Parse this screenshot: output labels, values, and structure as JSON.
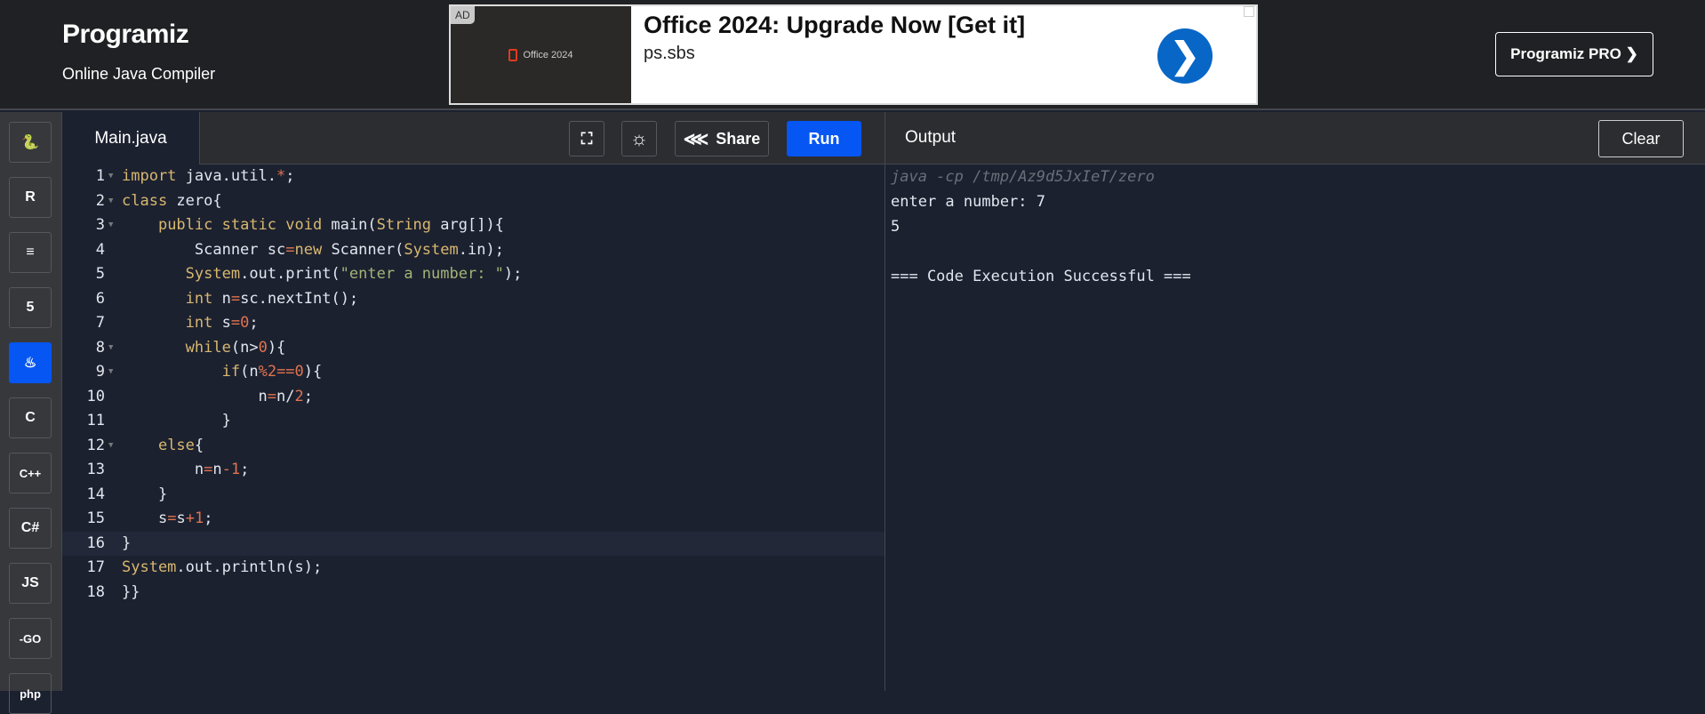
{
  "header": {
    "logo": "Programiz",
    "subtitle": "Online Java Compiler",
    "pro_button": "Programiz PRO ❯"
  },
  "ad": {
    "badge": "AD",
    "image_text": "Office 2024",
    "title": "Office 2024: Upgrade Now [Get it]",
    "url": "ps.sbs",
    "arrow": "❯"
  },
  "sidebar": {
    "items": [
      {
        "name": "python",
        "label": "🐍"
      },
      {
        "name": "r",
        "label": "R"
      },
      {
        "name": "sql",
        "label": "≡"
      },
      {
        "name": "html",
        "label": "5"
      },
      {
        "name": "java",
        "label": "♨",
        "active": true
      },
      {
        "name": "c",
        "label": "C"
      },
      {
        "name": "cpp",
        "label": "C++"
      },
      {
        "name": "csharp",
        "label": "C#"
      },
      {
        "name": "javascript",
        "label": "JS"
      },
      {
        "name": "go",
        "label": "-GO"
      },
      {
        "name": "php",
        "label": "php"
      }
    ]
  },
  "toolbar": {
    "tab": "Main.java",
    "fullscreen_icon": "⛶",
    "theme_icon": "☼",
    "share_label": "Share",
    "share_icon": "⋘",
    "run_label": "Run"
  },
  "editor": {
    "current_line": 16,
    "lines": [
      {
        "n": "1",
        "fold": true,
        "t": [
          [
            "kw",
            "import"
          ],
          [
            "p",
            " java.util."
          ],
          [
            "op",
            "*"
          ],
          [
            "p",
            ";"
          ]
        ]
      },
      {
        "n": "2",
        "fold": true,
        "t": [
          [
            "kw",
            "class"
          ],
          [
            "p",
            " zero{"
          ]
        ]
      },
      {
        "n": "3",
        "fold": true,
        "t": [
          [
            "p",
            "    "
          ],
          [
            "kw",
            "public static void"
          ],
          [
            "p",
            " main("
          ],
          [
            "kw",
            "String"
          ],
          [
            "p",
            " arg[]){"
          ]
        ]
      },
      {
        "n": "4",
        "t": [
          [
            "p",
            "        Scanner sc"
          ],
          [
            "op",
            "="
          ],
          [
            "kw",
            "new"
          ],
          [
            "p",
            " Scanner("
          ],
          [
            "kw",
            "System"
          ],
          [
            "p",
            ".in);"
          ]
        ]
      },
      {
        "n": "5",
        "t": [
          [
            "p",
            "       "
          ],
          [
            "kw",
            "System"
          ],
          [
            "p",
            ".out.print("
          ],
          [
            "str",
            "\"enter a number: \""
          ],
          [
            "p",
            ");"
          ]
        ]
      },
      {
        "n": "6",
        "t": [
          [
            "p",
            "       "
          ],
          [
            "kw",
            "int"
          ],
          [
            "p",
            " n"
          ],
          [
            "op",
            "="
          ],
          [
            "p",
            "sc.nextInt();"
          ]
        ]
      },
      {
        "n": "7",
        "t": [
          [
            "p",
            "       "
          ],
          [
            "kw",
            "int"
          ],
          [
            "p",
            " s"
          ],
          [
            "op",
            "="
          ],
          [
            "num",
            "0"
          ],
          [
            "p",
            ";"
          ]
        ]
      },
      {
        "n": "8",
        "fold": true,
        "t": [
          [
            "p",
            "       "
          ],
          [
            "kw",
            "while"
          ],
          [
            "p",
            "(n>"
          ],
          [
            "num",
            "0"
          ],
          [
            "p",
            "){"
          ]
        ]
      },
      {
        "n": "9",
        "fold": true,
        "t": [
          [
            "p",
            "           "
          ],
          [
            "kw",
            "if"
          ],
          [
            "p",
            "(n"
          ],
          [
            "op",
            "%"
          ],
          [
            "num",
            "2"
          ],
          [
            "op",
            "=="
          ],
          [
            "num",
            "0"
          ],
          [
            "p",
            "){"
          ]
        ]
      },
      {
        "n": "10",
        "t": [
          [
            "p",
            "               n"
          ],
          [
            "op",
            "="
          ],
          [
            "p",
            "n/"
          ],
          [
            "num",
            "2"
          ],
          [
            "p",
            ";"
          ]
        ]
      },
      {
        "n": "11",
        "t": [
          [
            "p",
            "           }"
          ]
        ]
      },
      {
        "n": "12",
        "fold": true,
        "t": [
          [
            "p",
            "    "
          ],
          [
            "kw",
            "else"
          ],
          [
            "p",
            "{"
          ]
        ]
      },
      {
        "n": "13",
        "t": [
          [
            "p",
            "        n"
          ],
          [
            "op",
            "="
          ],
          [
            "p",
            "n"
          ],
          [
            "op",
            "-"
          ],
          [
            "num",
            "1"
          ],
          [
            "p",
            ";"
          ]
        ]
      },
      {
        "n": "14",
        "t": [
          [
            "p",
            "    }"
          ]
        ]
      },
      {
        "n": "15",
        "t": [
          [
            "p",
            "    s"
          ],
          [
            "op",
            "="
          ],
          [
            "p",
            "s"
          ],
          [
            "op",
            "+"
          ],
          [
            "num",
            "1"
          ],
          [
            "p",
            ";"
          ]
        ]
      },
      {
        "n": "16",
        "t": [
          [
            "p",
            "}"
          ]
        ]
      },
      {
        "n": "17",
        "t": [
          [
            "kw",
            "System"
          ],
          [
            "p",
            ".out.println(s);"
          ]
        ]
      },
      {
        "n": "18",
        "t": [
          [
            "p",
            "}}"
          ]
        ]
      }
    ]
  },
  "output": {
    "label": "Output",
    "clear_label": "Clear",
    "lines": [
      {
        "text": "java -cp /tmp/Az9d5JxIeT/zero",
        "cmd": true
      },
      {
        "text": "enter a number: 7"
      },
      {
        "text": "5"
      },
      {
        "text": ""
      },
      {
        "text": "=== Code Execution Successful ==="
      }
    ]
  },
  "colors": {
    "accent": "#0556f3",
    "keyword": "#d8b86f",
    "number": "#e0734f",
    "string": "#a5b376"
  }
}
